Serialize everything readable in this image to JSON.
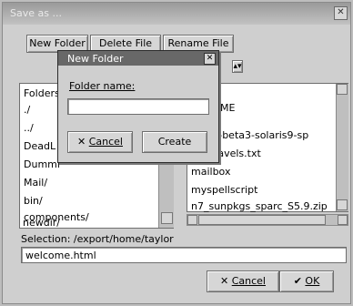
{
  "window": {
    "title": "Save as ..."
  },
  "toolbar": {
    "new_folder": "New Folder",
    "delete_file": "Delete File",
    "rename_file": "Rename File"
  },
  "folders": {
    "header": "Folders",
    "items": [
      "./",
      "../",
      "DeadL",
      "Dummi",
      "Mail/",
      "bin/",
      "components/",
      "newdir/"
    ]
  },
  "files": {
    "header": "ME",
    "items": [
      "e-2_0-beta3-solaris9-sp",
      "ers.travels.txt",
      "mailbox",
      "myspellscript",
      "n7_sunpkgs_sparc_S5.9.zip"
    ]
  },
  "selection": {
    "label": "Selection: /export/home/taylor",
    "value": "welcome.html"
  },
  "bottom_buttons": {
    "cancel": "Cancel",
    "ok": "OK"
  },
  "new_folder_dialog": {
    "title": "New Folder",
    "field_label": "Folder name:",
    "field_value": "",
    "cancel": "Cancel",
    "create": "Create"
  },
  "colors": {
    "accent": "#e84b5a",
    "panel": "#cfcfcf"
  }
}
